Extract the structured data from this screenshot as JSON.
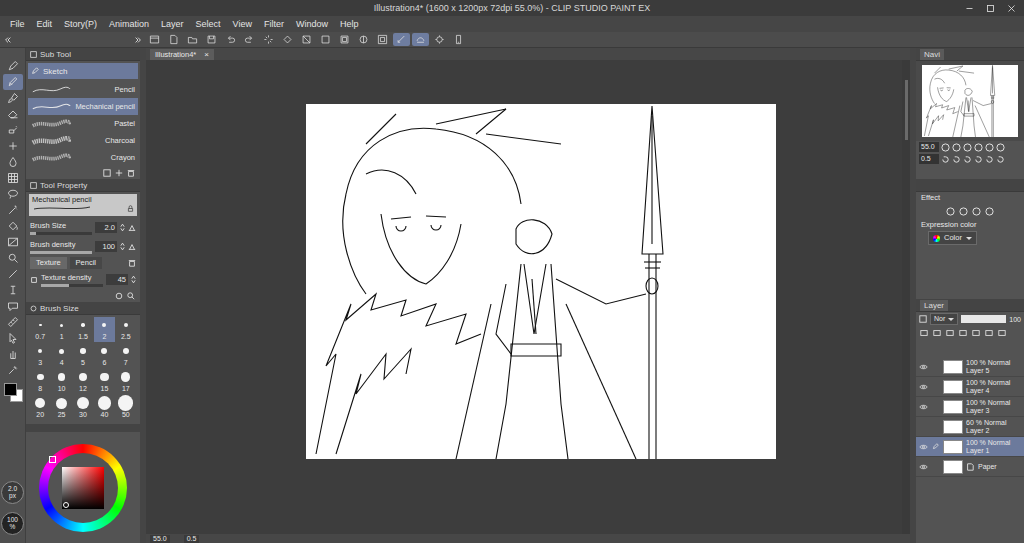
{
  "window": {
    "title": "Illustration4* (1600 x 1200px 72dpi 55.0%) - CLIP STUDIO PAINT EX"
  },
  "menu": [
    "File",
    "Edit",
    "Story(P)",
    "Animation",
    "Layer",
    "Select",
    "View",
    "Filter",
    "Window",
    "Help"
  ],
  "command_bar": [
    {
      "on": false
    },
    {
      "on": false
    },
    {
      "on": false
    },
    {
      "on": false
    },
    {
      "on": false
    },
    {
      "on": false
    },
    {
      "on": false
    },
    {
      "on": false
    },
    {
      "on": false
    },
    {
      "on": false
    },
    {
      "on": false
    },
    {
      "on": false
    },
    {
      "on": false
    },
    {
      "on": true
    },
    {
      "on": true
    },
    {
      "on": false
    },
    {
      "on": false
    }
  ],
  "tools": [
    {
      "selected": false
    },
    {
      "selected": true
    },
    {
      "selected": false
    },
    {
      "selected": false
    },
    {
      "selected": false
    },
    {
      "selected": false
    },
    {
      "selected": false
    },
    {
      "selected": false
    },
    {
      "selected": false
    },
    {
      "selected": false
    },
    {
      "selected": false
    },
    {
      "selected": false
    },
    {
      "selected": false
    },
    {
      "selected": false
    },
    {
      "selected": false
    },
    {
      "selected": false
    },
    {
      "selected": false
    },
    {
      "selected": false
    },
    {
      "selected": false
    },
    {
      "selected": false
    }
  ],
  "document_tab": {
    "label": "Illustration4*",
    "close": "×"
  },
  "sub_tool": {
    "title": "Sub Tool",
    "group": {
      "label": "Sketch",
      "selected": true
    },
    "items": [
      {
        "label": "Pencil",
        "selected": false
      },
      {
        "label": "Mechanical pencil",
        "selected": true
      },
      {
        "label": "Pastel",
        "selected": false
      },
      {
        "label": "Charcoal",
        "selected": false
      },
      {
        "label": "Crayon",
        "selected": false
      }
    ]
  },
  "tool_property": {
    "title": "Tool Property",
    "preset": "Mechanical pencil",
    "rows": [
      {
        "label": "Brush Size",
        "value": "2.0",
        "level": 0.1
      },
      {
        "label": "Brush density",
        "value": "100",
        "level": 1
      }
    ],
    "tabs": [
      {
        "label": "Texture",
        "selected": true
      },
      {
        "label": "Pencil",
        "selected": false
      }
    ],
    "texture_density": {
      "label": "Texture density",
      "value": "45",
      "level": 0.45
    }
  },
  "brush_size": {
    "title": "Brush Size",
    "sizes": [
      {
        "label": "0.7",
        "selected": false
      },
      {
        "label": "1",
        "selected": false
      },
      {
        "label": "1.5",
        "selected": false
      },
      {
        "label": "2",
        "selected": true
      },
      {
        "label": "2.5",
        "selected": false
      },
      {
        "label": "3",
        "selected": false
      },
      {
        "label": "4",
        "selected": false
      },
      {
        "label": "5",
        "selected": false
      },
      {
        "label": "6",
        "selected": false
      },
      {
        "label": "7",
        "selected": false
      },
      {
        "label": "8",
        "selected": false
      },
      {
        "label": "10",
        "selected": false
      },
      {
        "label": "12",
        "selected": false
      },
      {
        "label": "15",
        "selected": false
      },
      {
        "label": "17",
        "selected": false
      },
      {
        "label": "20",
        "selected": false
      },
      {
        "label": "25",
        "selected": false
      },
      {
        "label": "30",
        "selected": false
      },
      {
        "label": "40",
        "selected": false
      },
      {
        "label": "50",
        "selected": false
      }
    ]
  },
  "colors": {
    "main": "#000000",
    "sub": "#ffffff"
  },
  "indicators": {
    "size": "2.0",
    "size_unit": "px",
    "opacity": "100",
    "opacity_unit": "%"
  },
  "navigator": {
    "title": "Navi",
    "zoom": "55.0",
    "rotation": "0.5"
  },
  "effect": {
    "title": "Effect",
    "expression_label": "Expression color",
    "expression_value": "Color"
  },
  "layer_panel": {
    "title": "Layer",
    "blend": "Nor",
    "opacity": "100",
    "layers": [
      {
        "name": "Layer 5",
        "mode": "100 % Normal",
        "kind": "raster",
        "visible": true,
        "selected": false,
        "editing": false
      },
      {
        "name": "Layer 4",
        "mode": "100 % Normal",
        "kind": "raster",
        "visible": true,
        "selected": false,
        "editing": false
      },
      {
        "name": "Layer 3",
        "mode": "100 % Normal",
        "kind": "raster",
        "visible": true,
        "selected": false,
        "editing": false
      },
      {
        "name": "Layer 2",
        "mode": "60 % Normal",
        "kind": "raster",
        "visible": false,
        "selected": false,
        "editing": false
      },
      {
        "name": "Layer 1",
        "mode": "100 % Normal",
        "kind": "raster",
        "visible": true,
        "selected": true,
        "editing": true
      },
      {
        "name": "Paper",
        "kind": "paper",
        "visible": true,
        "selected": false,
        "editing": false
      }
    ]
  },
  "status_bar": {
    "zoom": "55.0",
    "rotation": "0.5"
  }
}
